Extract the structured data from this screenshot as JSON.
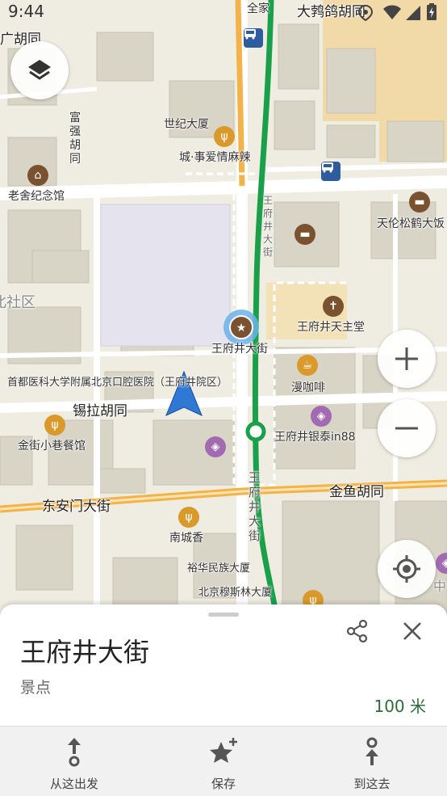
{
  "status_bar": {
    "time": "9:44"
  },
  "map": {
    "labels": {
      "quanjia": "全家",
      "dapengge": "大鹁鸽胡同",
      "guang": "广胡同",
      "fuqiang": "富强胡同",
      "shiji": "世纪大厦",
      "chengshi": "城·事爱情麻辣",
      "laoshe": "老舍纪念馆",
      "tianlun": "天伦松鹤大饭",
      "shequ": "北社区",
      "wangfujing_poi": "王府井大街",
      "tianzhutang": "王府井天主堂",
      "hospital": "首都医科大学附属北京口腔医院（王府井院区）",
      "manka": "漫咖啡",
      "xila": "锡拉胡同",
      "jinjie": "金街小巷餐馆",
      "yintai": "王府井银泰in88",
      "donganmen": "东安门大街",
      "jinyu": "金鱼胡同",
      "nancheng": "南城香",
      "yuhua": "裕华民族大厦",
      "musilin": "北京穆斯林大厦",
      "street_vertical1": "王府井大街",
      "street_vertical2": "王府井大街",
      "zhong": "中"
    }
  },
  "place": {
    "name": "王府井大街",
    "category": "景点",
    "distance": "100 米"
  },
  "actions": {
    "from_here": "从这出发",
    "save": "保存",
    "go_here": "到这去"
  },
  "colors": {
    "route": "#1aa04a",
    "main_road": "#f4b24a",
    "building": "#d9d5c8",
    "water_block": "#e3e2ee"
  }
}
